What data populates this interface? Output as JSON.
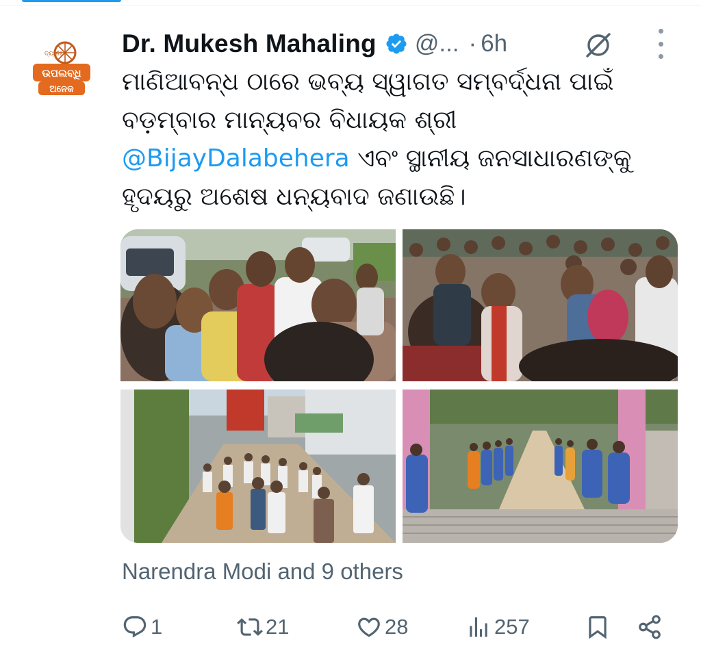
{
  "tweet": {
    "avatar_logo_text": [
      "ଦ୍ୟ ନିଃ",
      "ଉପଲବ୍ଧି",
      "ଅନେକ"
    ],
    "author_name": "Dr. Mukesh Mahaling",
    "handle": "@...",
    "separator": "·",
    "time": "6h",
    "body_parts": [
      "ମାଣିଆବନ୍ଧ ଠାରେ ଭବ୍ୟ ସ୍ୱାଗତ ସମ୍ବର୍ଦ୍ଧନା ପାଇଁ ବଡ଼ମ୍ବାର ମାନ୍ୟବର ବିଧାୟକ ଶ୍ରୀ ",
      "@BijayDalabehera",
      " ଏବଂ ସ୍ଥାନୀୟ ଜନସାଧାରଣଙ୍କୁ ହୃଦୟରୁ ଅଶେଷ ଧନ୍ୟବାଦ ଜଣାଉଛି।"
    ],
    "media": [
      {
        "name": "crowd-greeting-photo"
      },
      {
        "name": "crowd-with-scarves-photo"
      },
      {
        "name": "street-procession-photo"
      },
      {
        "name": "gate-welcome-line-photo"
      }
    ],
    "social_context": "Narendra Modi and 9 others",
    "actions": {
      "reply_count": "1",
      "retweet_count": "21",
      "like_count": "28",
      "view_count": "257"
    },
    "colors": {
      "accent": "#1d9bf0",
      "secondary_text": "#536471",
      "primary_text": "#0f1419"
    },
    "icons": [
      "verified-badge-icon",
      "grok-icon",
      "more-icon",
      "reply-icon",
      "retweet-icon",
      "like-icon",
      "views-icon",
      "bookmark-icon",
      "share-icon"
    ]
  }
}
